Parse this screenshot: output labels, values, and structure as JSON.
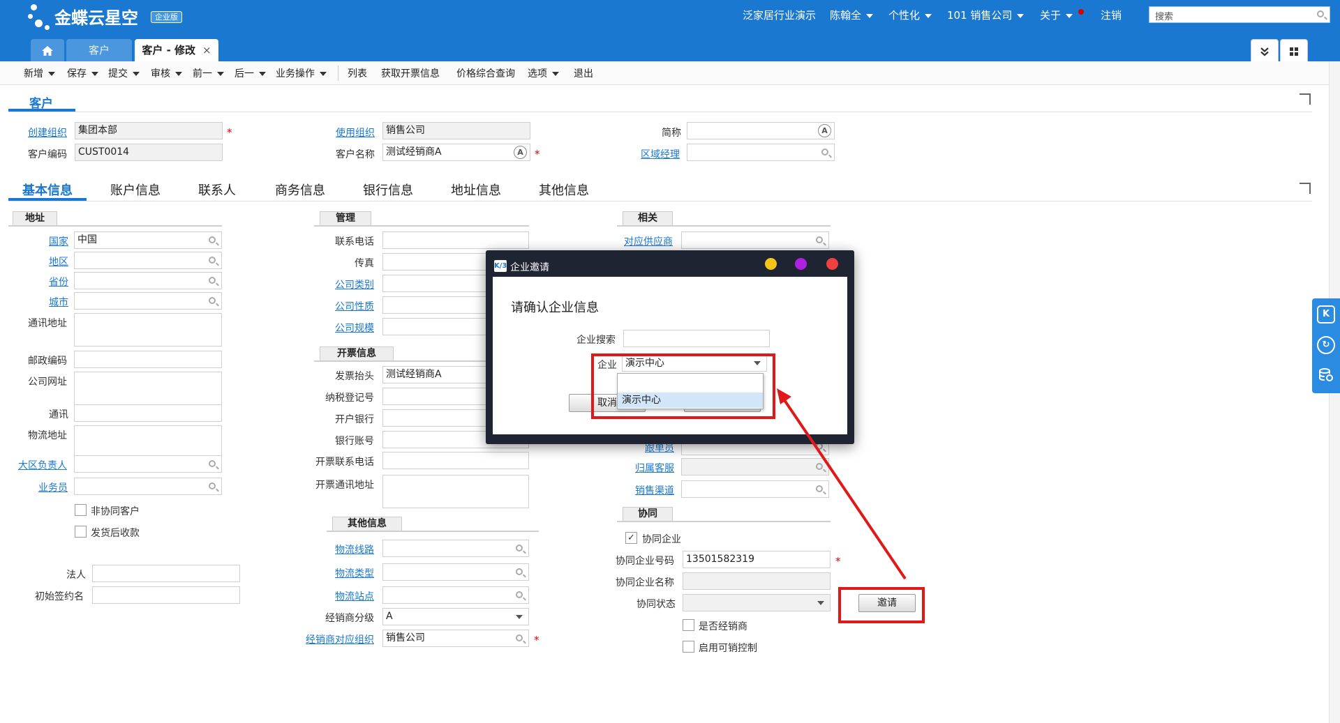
{
  "header": {
    "logo_text": "金蝶云星空",
    "logo_badge": "企业版",
    "nav": {
      "tenant": "泛家居行业演示",
      "user": "陈翰全",
      "personalize": "个性化",
      "org": "101  销售公司",
      "about": "关于",
      "logout": "注销"
    },
    "search_placeholder": "搜索"
  },
  "tabs": {
    "home_icon": "home-icon",
    "customer": "客户",
    "edit": "客户 - 修改",
    "close": "×",
    "collapse_icon": "chevron-double-down-icon",
    "grid_icon": "grid-icon"
  },
  "toolbar": {
    "new": "新增",
    "save": "保存",
    "submit": "提交",
    "audit": "审核",
    "prev": "前一",
    "next": "后一",
    "ops": "业务操作",
    "list": "列表",
    "invoice_info": "获取开票信息",
    "price_query": "价格综合查询",
    "options": "选项",
    "exit": "退出"
  },
  "header_form": {
    "section_title": "客户",
    "create_org_label": "创建组织",
    "create_org_value": "集团本部",
    "customer_code_label": "客户编码",
    "customer_code_value": "CUST0014",
    "use_org_label": "使用组织",
    "use_org_value": "销售公司",
    "customer_name_label": "客户名称",
    "customer_name_value": "测试经销商A",
    "short_name_label": "简称",
    "short_name_value": "",
    "region_manager_label": "区域经理",
    "region_manager_value": ""
  },
  "body_tabs": [
    "基本信息",
    "账户信息",
    "联系人",
    "商务信息",
    "银行信息",
    "地址信息",
    "其他信息"
  ],
  "address": {
    "group": "地址",
    "country_label": "国家",
    "country_value": "中国",
    "region_label": "地区",
    "province_label": "省份",
    "city_label": "城市",
    "mail_address_label": "通讯地址",
    "zip_label": "邮政编码",
    "website_label": "公司网址",
    "comm_label": "通讯",
    "logistics_address_label": "物流地址",
    "area_leader_label": "大区负责人",
    "salesman_label": "业务员",
    "non_collab_label": "非协同客户",
    "pay_after_ship_label": "发货后收款",
    "legal_person_label": "法人",
    "initial_contract_label": "初始签约名"
  },
  "management": {
    "group": "管理",
    "phone_label": "联系电话",
    "fax_label": "传真",
    "company_type_label": "公司类别",
    "company_nature_label": "公司性质",
    "company_scale_label": "公司规模"
  },
  "invoice": {
    "group": "开票信息",
    "title_label": "发票抬头",
    "title_value": "测试经销商A",
    "tax_no_label": "纳税登记号",
    "bank_label": "开户银行",
    "account_label": "银行账号",
    "phone_label": "开票联系电话",
    "address_label": "开票通讯地址"
  },
  "other": {
    "group": "其他信息",
    "logistics_route_label": "物流线路",
    "logistics_type_label": "物流类型",
    "logistics_station_label": "物流站点",
    "dealer_level_label": "经销商分级",
    "dealer_level_value": "A",
    "dealer_org_label": "经销商对应组织",
    "dealer_org_value": "销售公司"
  },
  "related": {
    "group": "相关",
    "supplier_label": "对应供应商",
    "dispatcher_label": "跟单员",
    "service_label": "归属客服",
    "channel_label": "销售渠道"
  },
  "collab": {
    "group": "协同",
    "collab_company_label": "协同企业",
    "collab_code_label": "协同企业号码",
    "collab_code_value": "13501582319",
    "collab_name_label": "协同企业名称",
    "collab_status_label": "协同状态",
    "is_dealer_label": "是否经销商",
    "enable_control_label": "启用可销控制",
    "invite_button": "邀请"
  },
  "dialog": {
    "title": "企业邀请",
    "k3_badge": "K/3",
    "heading": "请确认企业信息",
    "search_label": "企业搜索",
    "company_label": "企业",
    "company_value": "演示中心",
    "option": "演示中心",
    "cancel": "取消"
  },
  "sidedock": {
    "k_badge": "K"
  },
  "colors": {
    "brand_blue": "#1a78d0",
    "highlight_red": "#e01818",
    "dot_yellow": "#f5c518",
    "dot_purple": "#b020e0",
    "dot_red": "#f04040"
  }
}
